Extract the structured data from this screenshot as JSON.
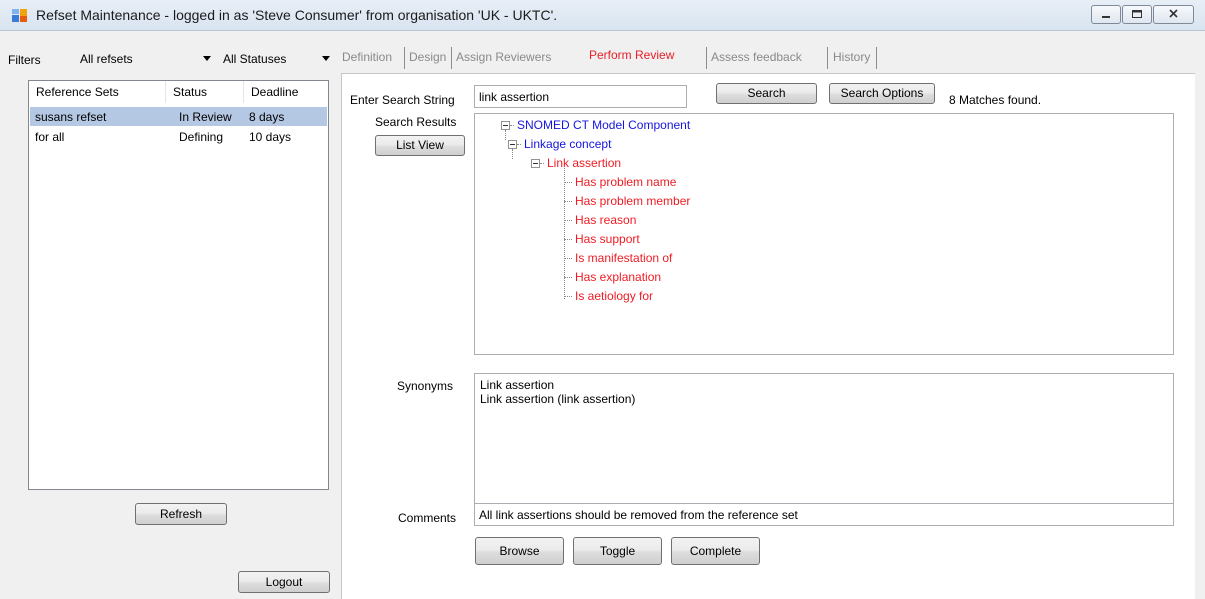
{
  "window": {
    "title": "Refset Maintenance - logged in as 'Steve Consumer' from organisation 'UK - UKTC'."
  },
  "filters": {
    "label": "Filters",
    "refset_filter": "All refsets",
    "status_filter": "All Statuses"
  },
  "reference_sets": {
    "columns": [
      "Reference Sets",
      "Status",
      "Deadline"
    ],
    "rows": [
      {
        "name": "susans refset",
        "status": "In Review",
        "deadline": "8 days",
        "selected": true
      },
      {
        "name": "for all",
        "status": "Defining",
        "deadline": "10 days",
        "selected": false
      }
    ]
  },
  "left_buttons": {
    "refresh": "Refresh",
    "logout": "Logout"
  },
  "tabs": [
    {
      "label": "Definition",
      "active": false
    },
    {
      "label": "Design",
      "active": false
    },
    {
      "label": "Assign Reviewers",
      "active": false
    },
    {
      "label": "Perform Review",
      "active": true
    },
    {
      "label": "Assess feedback",
      "active": false
    },
    {
      "label": "History",
      "active": false
    }
  ],
  "review": {
    "search_label": "Enter Search String",
    "search_value": "link assertion",
    "search_button": "Search",
    "search_options_button": "Search Options",
    "matches": "8 Matches found.",
    "results_label": "Search Results",
    "list_view_button": "List View",
    "tree": {
      "root": "SNOMED CT Model Component",
      "level1": "Linkage concept",
      "level2": "Link assertion",
      "leaves": [
        "Has problem name",
        "Has problem member",
        "Has reason",
        "Has support",
        "Is manifestation of",
        "Has explanation",
        "Is aetiology for"
      ]
    },
    "synonyms_label": "Synonyms",
    "synonyms": [
      "Link assertion",
      "Link assertion (link assertion)"
    ],
    "comments_label": "Comments",
    "comments_value": "All link assertions should be removed from the reference set",
    "buttons": {
      "browse": "Browse",
      "toggle": "Toggle",
      "complete": "Complete"
    }
  },
  "colors": {
    "tree_blue": "#1515e0",
    "tree_red": "#ee1c24",
    "active_tab": "#e8202a",
    "selected_row": "#b5c8e3"
  }
}
